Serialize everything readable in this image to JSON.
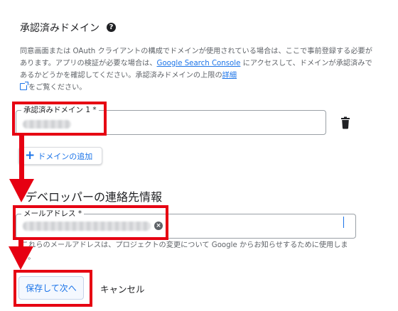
{
  "section": {
    "title": "承認済みドメイン",
    "help_icon": "help-circle-icon",
    "description_part1": "同意画面または OAuth クライアントの構成でドメインが使用されている場合は、ここで事前登録する必要があります。アプリの検証が必要な場合は、",
    "console_link": "Google Search Console",
    "description_part2": " にアクセスして、ドメインが承認済みであるかどうかを確認してください。承認済みドメインの上限の",
    "details_link": "詳細",
    "description_part3": "をご覧ください。"
  },
  "domain_field": {
    "label": "承認済みドメイン 1 *",
    "delete_icon": "trash-icon"
  },
  "add_domain_button": {
    "icon": "plus-icon",
    "label": "ドメインの追加"
  },
  "developer_contact": {
    "title": "デベロッパーの連絡先情報",
    "email_label": "メールアドレス *",
    "clear_icon": "clear-icon",
    "note": "これらのメールアドレスは、プロジェクトの変更について Google からお知らせするために使用します。"
  },
  "actions": {
    "save_label": "保存して次へ",
    "cancel_label": "キャンセル"
  },
  "colors": {
    "accent": "#1a73e8",
    "highlight": "#e60012",
    "text_secondary": "#5f6368"
  }
}
